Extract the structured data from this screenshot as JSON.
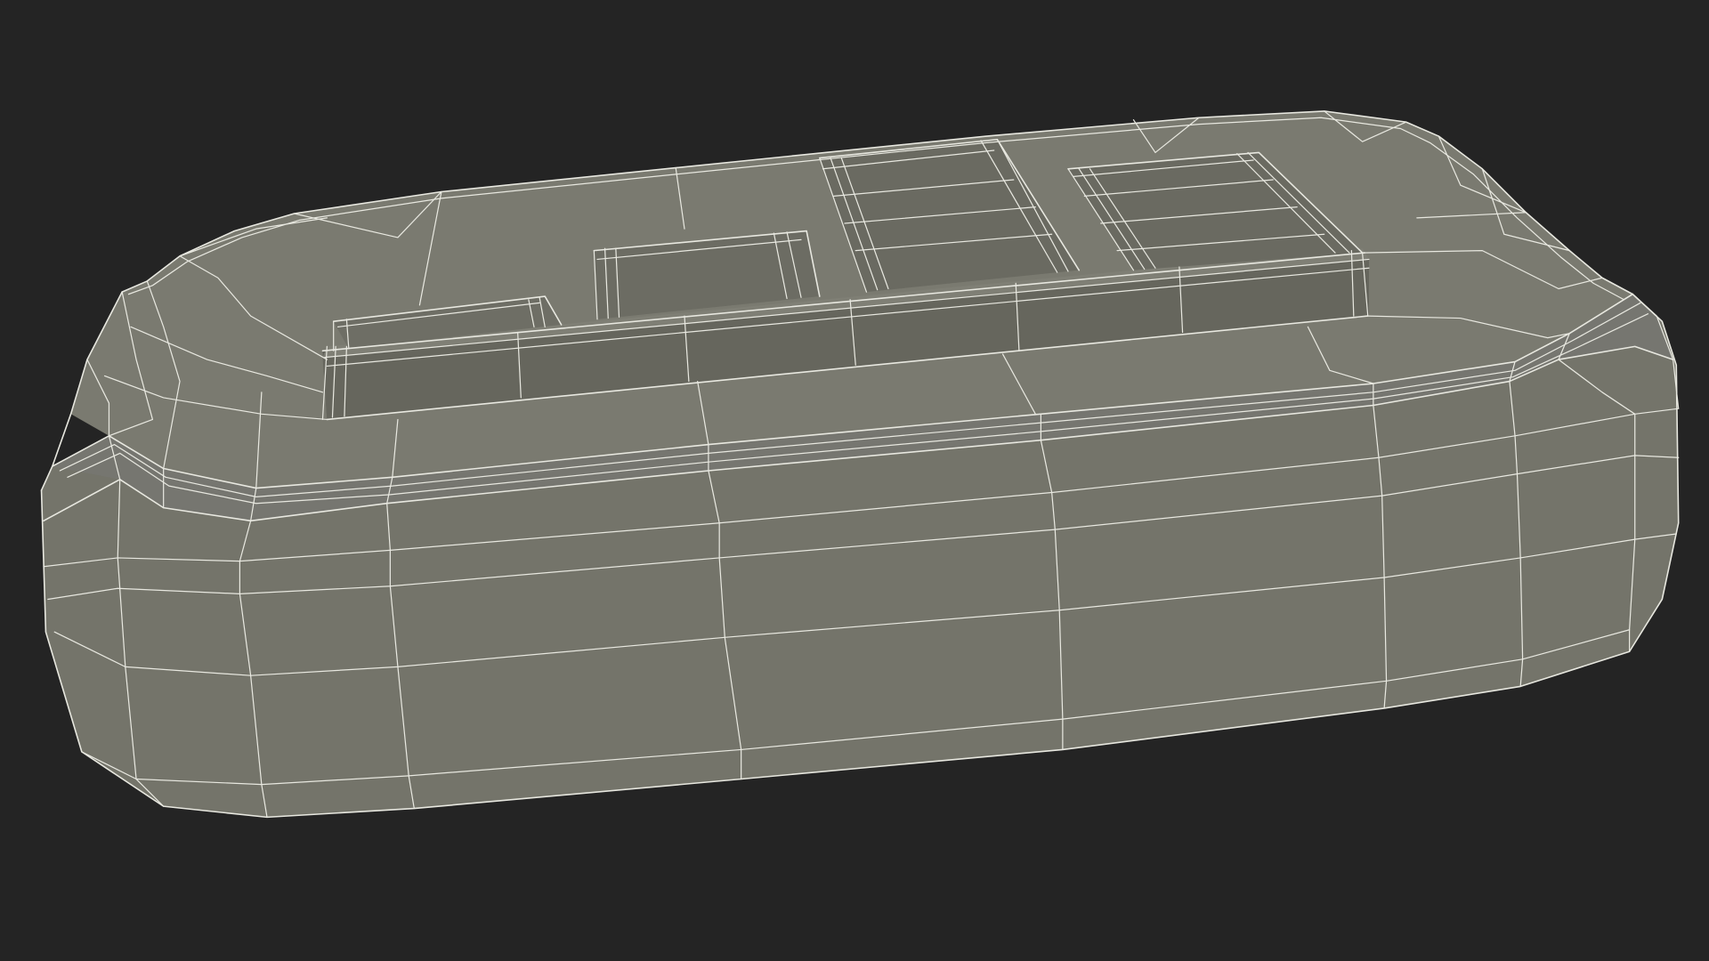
{
  "scene": {
    "subject": "wireframe-3d-model",
    "colors": {
      "background": "#242424",
      "top_face": "#7a7a70",
      "side_face": "#74746a",
      "shadow_face": "#5f5f57",
      "wire": "#e8e8e0"
    }
  }
}
